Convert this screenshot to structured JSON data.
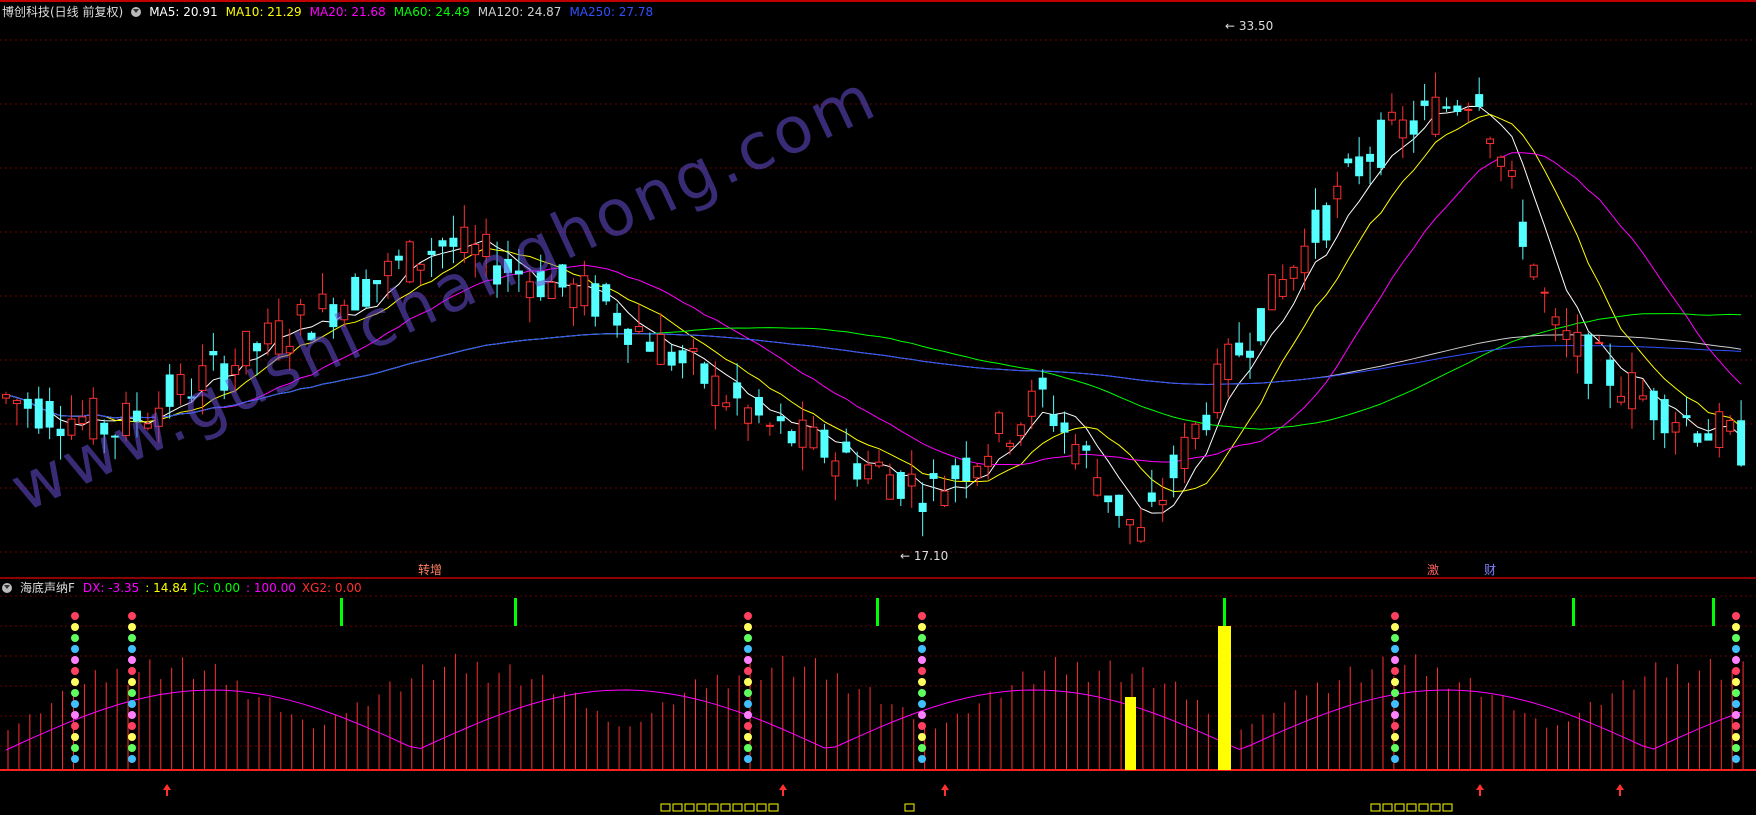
{
  "header": {
    "title": "博创科技(日线 前复权)",
    "ma_labels": [
      {
        "text": "MA5: 20.91",
        "color": "#ffffff"
      },
      {
        "text": "MA10: 21.29",
        "color": "#ffff00"
      },
      {
        "text": "MA20: 21.68",
        "color": "#ff00ff"
      },
      {
        "text": "MA60: 24.49",
        "color": "#00ff00"
      },
      {
        "text": "MA120: 24.87",
        "color": "#cfcfcf"
      },
      {
        "text": "MA250: 27.78",
        "color": "#3050ff"
      }
    ]
  },
  "indicator_header": {
    "title": "海底声纳F",
    "values": [
      {
        "text": "DX: -3.35",
        "color": "#ff00ff"
      },
      {
        "text": ": 14.84",
        "color": "#ffff00"
      },
      {
        "text": "JC: 0.00",
        "color": "#00ff00"
      },
      {
        "text": ": 100.00",
        "color": "#ff00ff"
      },
      {
        "text": "XG2: 0.00",
        "color": "#ff3030"
      }
    ]
  },
  "annotations": {
    "high_label": "33.50",
    "low_label": "17.10",
    "marker_texts": [
      "转增",
      "激",
      "财"
    ]
  },
  "watermark": "www.gushichanghong.com",
  "chart_data": {
    "type": "candlestick",
    "price_range": [
      17.1,
      33.5
    ],
    "high": 33.5,
    "low": 17.1,
    "series": [
      {
        "name": "MA5",
        "value": 20.91,
        "color": "#ffffff"
      },
      {
        "name": "MA10",
        "value": 21.29,
        "color": "#ffff00"
      },
      {
        "name": "MA20",
        "value": 21.68,
        "color": "#ff00ff"
      },
      {
        "name": "MA60",
        "value": 24.49,
        "color": "#00ff00"
      },
      {
        "name": "MA120",
        "value": 24.87,
        "color": "#cfcfcf"
      },
      {
        "name": "MA250",
        "value": 27.78,
        "color": "#3050ff"
      }
    ],
    "indicator": {
      "name": "海底声纳F",
      "DX": -3.35,
      "value2": 14.84,
      "JC": 0.0,
      "value4": 100.0,
      "XG2": 0.0
    },
    "colors": {
      "up": "#ff3030",
      "down": "#54ffff",
      "grid": "#8b0000",
      "divider": "#c00000"
    }
  }
}
